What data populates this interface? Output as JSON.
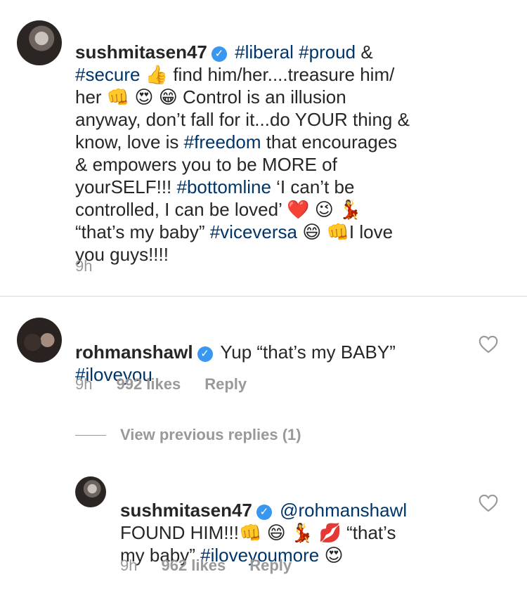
{
  "post": {
    "username": "sushmitasen47",
    "verified_icon": "verified-badge-icon",
    "caption_parts": [
      {
        "t": " "
      },
      {
        "t": "#liberal",
        "tag": true
      },
      {
        "t": " "
      },
      {
        "t": "#proud",
        "tag": true
      },
      {
        "t": " &\n"
      },
      {
        "t": "#secure",
        "tag": true
      },
      {
        "t": " 👍 find him/her....treasure him/\nher 👊 😍 😁 Control is an illusion\nanyway, don’t fall for it...do YOUR thing &\nknow, love is "
      },
      {
        "t": "#freedom",
        "tag": true
      },
      {
        "t": " that encourages\n& empowers you to be MORE of\nyourSELF!!! "
      },
      {
        "t": "#bottomline",
        "tag": true
      },
      {
        "t": " ‘I can’t be\ncontrolled, I can be loved’ ❤️ 😉 💃\n“that’s my baby” "
      },
      {
        "t": "#viceversa",
        "tag": true
      },
      {
        "t": " 😄 👊I love\nyou guys!!!!"
      }
    ],
    "time": "9h"
  },
  "comment": {
    "username": "rohmanshawl",
    "text_parts": [
      {
        "t": " Yup “that’s my BABY”\n"
      },
      {
        "t": "#iloveyou",
        "tag": true
      }
    ],
    "time": "9h",
    "likes": "992 likes",
    "reply_label": "Reply"
  },
  "view_previous": "View previous replies (1)",
  "reply": {
    "username": "sushmitasen47",
    "text_parts": [
      {
        "t": " "
      },
      {
        "t": "@rohmanshawl",
        "tag": true
      },
      {
        "t": "\nFOUND HIM!!!👊 😄 💃 💋  “that’s\nmy baby” "
      },
      {
        "t": "#iloveyoumore",
        "tag": true
      },
      {
        "t": " 😍"
      }
    ],
    "time": "9h",
    "likes": "962 likes",
    "reply_label": "Reply"
  },
  "colors": {
    "hashtag": "#003569",
    "muted": "#999999",
    "verified": "#3897f0",
    "text": "#262626"
  }
}
